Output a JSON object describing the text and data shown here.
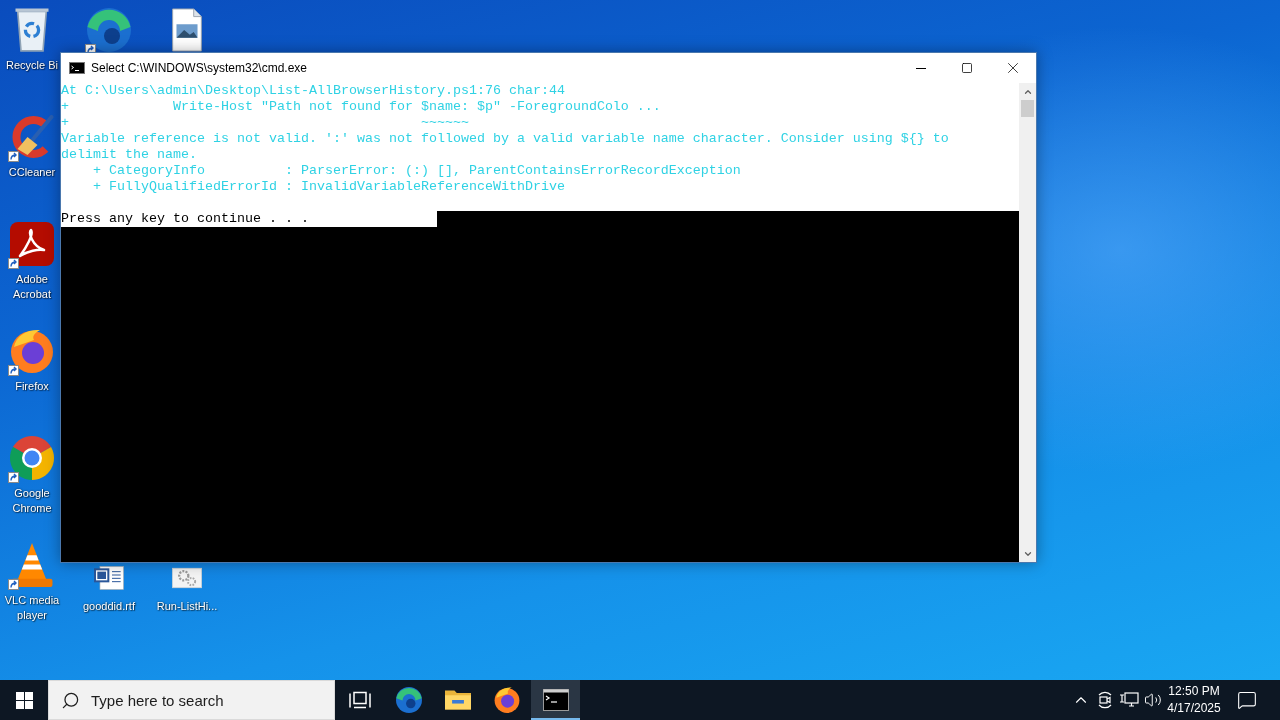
{
  "desktop_icons": [
    {
      "kind": "recycle_bin",
      "label": "Recycle Bi",
      "shortcut": false
    },
    {
      "kind": "ccleaner",
      "label": "CCleaner",
      "shortcut": true
    },
    {
      "kind": "acrobat",
      "label": "Adobe Acrobat",
      "shortcut": true
    },
    {
      "kind": "firefox",
      "label": "Firefox",
      "shortcut": true
    },
    {
      "kind": "chrome",
      "label": "Google Chrome",
      "shortcut": true
    },
    {
      "kind": "vlc",
      "label": "VLC media player",
      "shortcut": true
    },
    {
      "kind": "edge",
      "shortcut": true
    },
    {
      "kind": "word_doc",
      "label": "gooddid.rtf",
      "shortcut": false
    },
    {
      "kind": "image_file",
      "shortcut": false
    },
    {
      "kind": "settings_file",
      "label": "Run-ListHi...",
      "shortcut": false
    }
  ],
  "window": {
    "title": "Select C:\\WINDOWS\\system32\\cmd.exe",
    "lines": [
      {
        "kind": "error",
        "selected": true,
        "text": "At C:\\Users\\admin\\Desktop\\List-AllBrowserHistory.ps1:76 char:44"
      },
      {
        "kind": "error",
        "selected": true,
        "text": "+             Write-Host \"Path not found for $name: $p\" -ForegroundColo ..."
      },
      {
        "kind": "error",
        "selected": true,
        "text": "+                                            ~~~~~~"
      },
      {
        "kind": "error",
        "selected": true,
        "text": "Variable reference is not valid. ':' was not followed by a valid variable name character. Consider using ${} to"
      },
      {
        "kind": "error",
        "selected": true,
        "text": "delimit the name."
      },
      {
        "kind": "error",
        "selected": true,
        "text": "    + CategoryInfo          : ParserError: (:) [], ParentContainsErrorRecordException"
      },
      {
        "kind": "error",
        "selected": true,
        "text": "    + FullyQualifiedErrorId : InvalidVariableReferenceWithDrive"
      },
      {
        "kind": "blank",
        "selected": true
      },
      {
        "kind": "prompt",
        "selected": true,
        "text": "Press any key to continue . . ."
      }
    ]
  },
  "taskbar": {
    "search": {
      "placeholder": "Type here to search"
    },
    "apps": [
      {
        "kind": "task_view",
        "active": false
      },
      {
        "kind": "edge",
        "active": false
      },
      {
        "kind": "explorer",
        "active": false
      },
      {
        "kind": "firefox",
        "active": false
      },
      {
        "kind": "cmd",
        "active": true
      }
    ],
    "clock": {
      "time": "12:50 PM",
      "date": "4/17/2025"
    }
  }
}
